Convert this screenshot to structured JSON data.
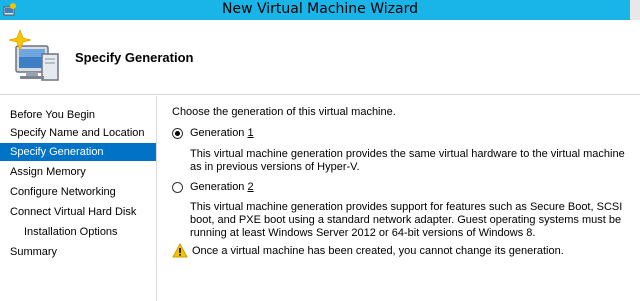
{
  "window": {
    "title": "New Virtual Machine Wizard"
  },
  "header": {
    "title": "Specify Generation",
    "icon": "virtual-machine-wizard-icon"
  },
  "sidebar": {
    "items": [
      {
        "label": "Before You Begin",
        "selected": false
      },
      {
        "label": "Specify Name and Location",
        "selected": false
      },
      {
        "label": "Specify Generation",
        "selected": true
      },
      {
        "label": "Assign Memory",
        "selected": false
      },
      {
        "label": "Configure Networking",
        "selected": false
      },
      {
        "label": "Connect Virtual Hard Disk",
        "selected": false
      },
      {
        "label": "Installation Options",
        "selected": false
      },
      {
        "label": "Summary",
        "selected": false
      }
    ],
    "selected_color": "#0073c6"
  },
  "main": {
    "prompt": "Choose the generation of this virtual machine.",
    "options": [
      {
        "label_prefix": "Generation ",
        "label_number": "1",
        "checked": true,
        "description": "This virtual machine generation provides the same virtual hardware to the virtual machine as in previous versions of Hyper-V."
      },
      {
        "label_prefix": "Generation ",
        "label_number": "2",
        "checked": false,
        "description": "This virtual machine generation provides support for features such as Secure Boot, SCSI boot, and PXE boot using a standard network adapter. Guest operating systems must be running at least Windows Server 2012 or 64-bit versions of Windows 8."
      }
    ],
    "warning": "Once a virtual machine has been created, you cannot change its generation.",
    "warning_icon": "warning-icon"
  },
  "colors": {
    "titlebar": "#19b4e8"
  }
}
